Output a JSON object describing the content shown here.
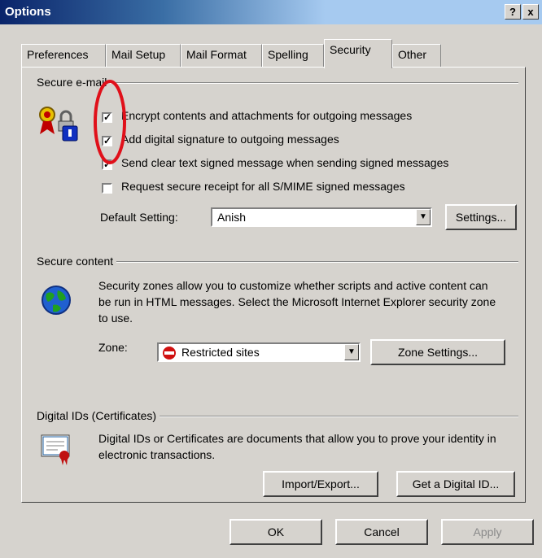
{
  "window": {
    "title": "Options",
    "help_button": "?",
    "close_button": "x"
  },
  "tabs": [
    "Preferences",
    "Mail Setup",
    "Mail Format",
    "Spelling",
    "Security",
    "Other"
  ],
  "active_tab": "Security",
  "secure_email": {
    "title": "Secure e-mail",
    "options": [
      {
        "label": "Encrypt contents and attachments for outgoing messages",
        "checked": true
      },
      {
        "label": "Add digital signature to outgoing messages",
        "checked": true
      },
      {
        "label": "Send clear text signed message when sending signed messages",
        "checked": true
      },
      {
        "label": "Request secure receipt for all S/MIME signed messages",
        "checked": false
      }
    ],
    "default_setting_label": "Default Setting:",
    "default_setting_value": "Anish",
    "settings_button": "Settings..."
  },
  "secure_content": {
    "title": "Secure content",
    "description": "Security zones allow you to customize whether scripts and active content can be run in HTML messages.  Select the Microsoft Internet Explorer security zone to use.",
    "zone_label": "Zone:",
    "zone_value": "Restricted sites",
    "zone_settings_button": "Zone Settings..."
  },
  "digital_ids": {
    "title": "Digital IDs (Certificates)",
    "description": "Digital IDs or Certificates are documents that allow you to prove your identity in electronic transactions.",
    "import_export_button": "Import/Export...",
    "get_id_button": "Get a Digital ID..."
  },
  "footer": {
    "ok": "OK",
    "cancel": "Cancel",
    "apply": "Apply"
  },
  "colors": {
    "annotation": "#e0101a",
    "titlebar": "#0a246a"
  }
}
